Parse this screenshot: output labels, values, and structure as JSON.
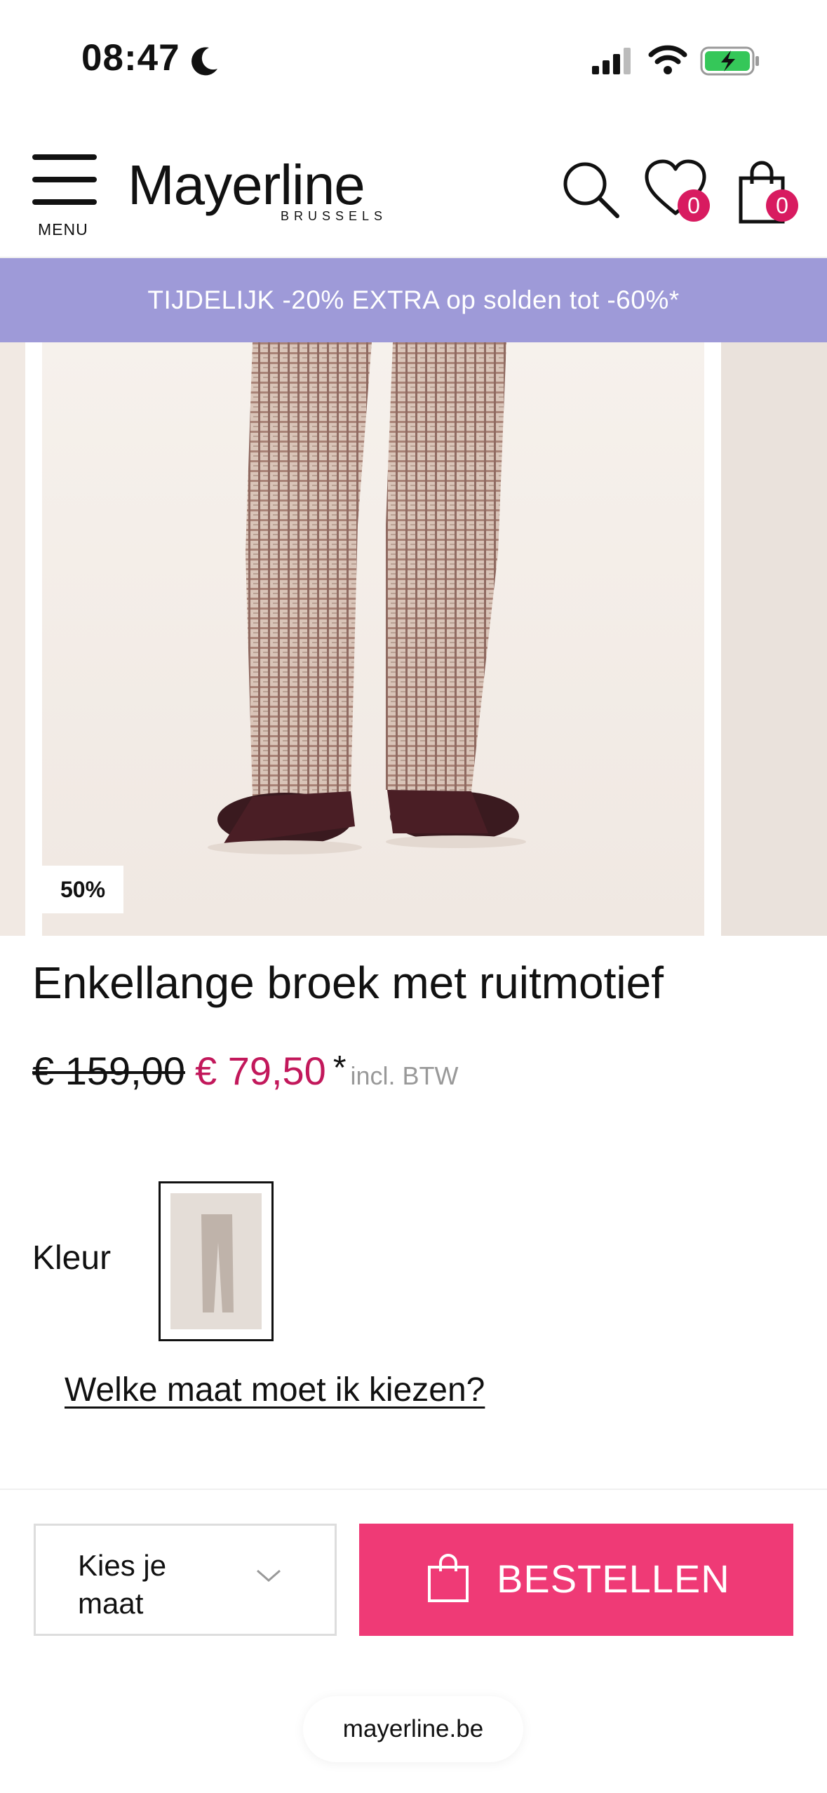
{
  "status_bar": {
    "time": "08:47",
    "icons": [
      "moon-icon",
      "cellular-signal-icon",
      "wifi-icon",
      "battery-charging-icon"
    ]
  },
  "header": {
    "menu_label": "MENU",
    "logo_main": "Mayerline",
    "logo_sub": "BRUSSELS",
    "wishlist_count": "0",
    "cart_count": "0",
    "icons": [
      "menu-icon",
      "search-icon",
      "heart-icon",
      "shopping-bag-icon"
    ]
  },
  "promo": {
    "text": "TIJDELIJK -20% EXTRA op solden tot -60%*"
  },
  "gallery": {
    "discount_badge": "50%"
  },
  "product": {
    "title": "Enkellange broek met ruitmotief",
    "old_price": "€ 159,00",
    "new_price": "€ 79,50",
    "asterisk": "*",
    "vat_note": "incl. BTW",
    "color_label": "Kleur",
    "size_guide_link": "Welke maat moet ik kiezen?"
  },
  "bottom_bar": {
    "size_select_label": "Kies je maat",
    "order_button": "BESTELLEN"
  },
  "browser": {
    "url": "mayerline.be"
  },
  "colors": {
    "promo_bg": "#9e9ad8",
    "accent_pink": "#ef3a76",
    "sale_price": "#c2185b",
    "badge_pink": "#d81b60"
  }
}
